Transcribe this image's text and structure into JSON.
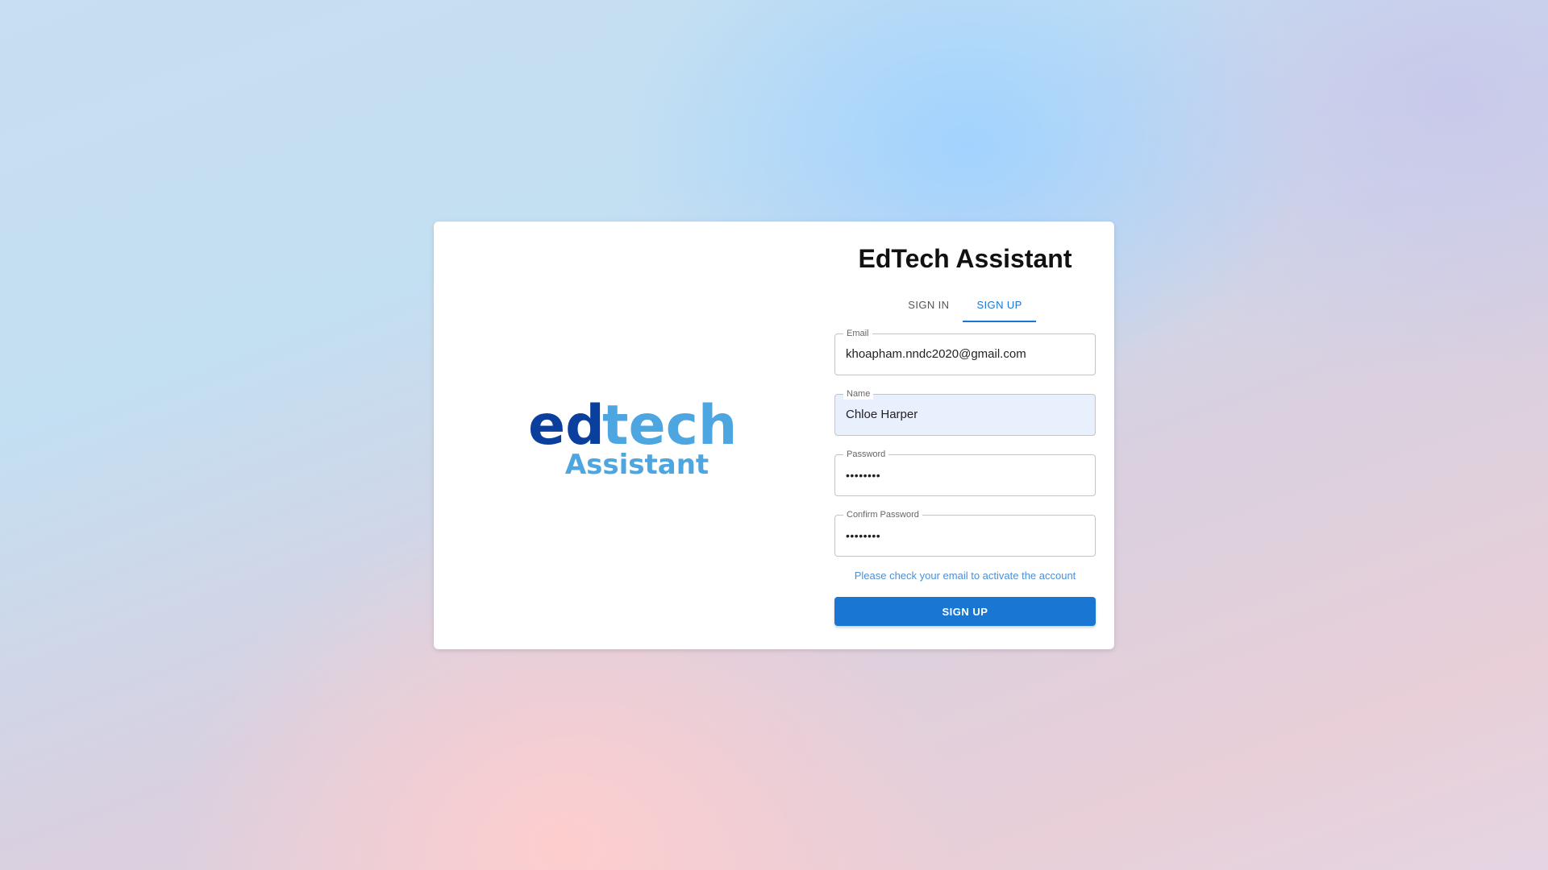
{
  "app": {
    "title": "EdTech Assistant"
  },
  "logo": {
    "part1": "ed",
    "part2": "tech",
    "subtitle": "Assistant",
    "color_dark": "#0b3f9e",
    "color_light": "#4da6e0"
  },
  "tabs": [
    {
      "label": "SIGN IN",
      "active": false
    },
    {
      "label": "SIGN UP",
      "active": true
    }
  ],
  "form": {
    "email": {
      "label": "Email",
      "value": "khoapham.nndc2020@gmail.com"
    },
    "name": {
      "label": "Name",
      "value": "Chloe Harper"
    },
    "password": {
      "label": "Password",
      "value": "••••••••"
    },
    "confirm_password": {
      "label": "Confirm Password",
      "value": "••••••••"
    },
    "notice": "Please check your email to activate the account",
    "submit_label": "SIGN UP"
  },
  "colors": {
    "accent": "#1976d2",
    "notice": "#4a90d9"
  }
}
